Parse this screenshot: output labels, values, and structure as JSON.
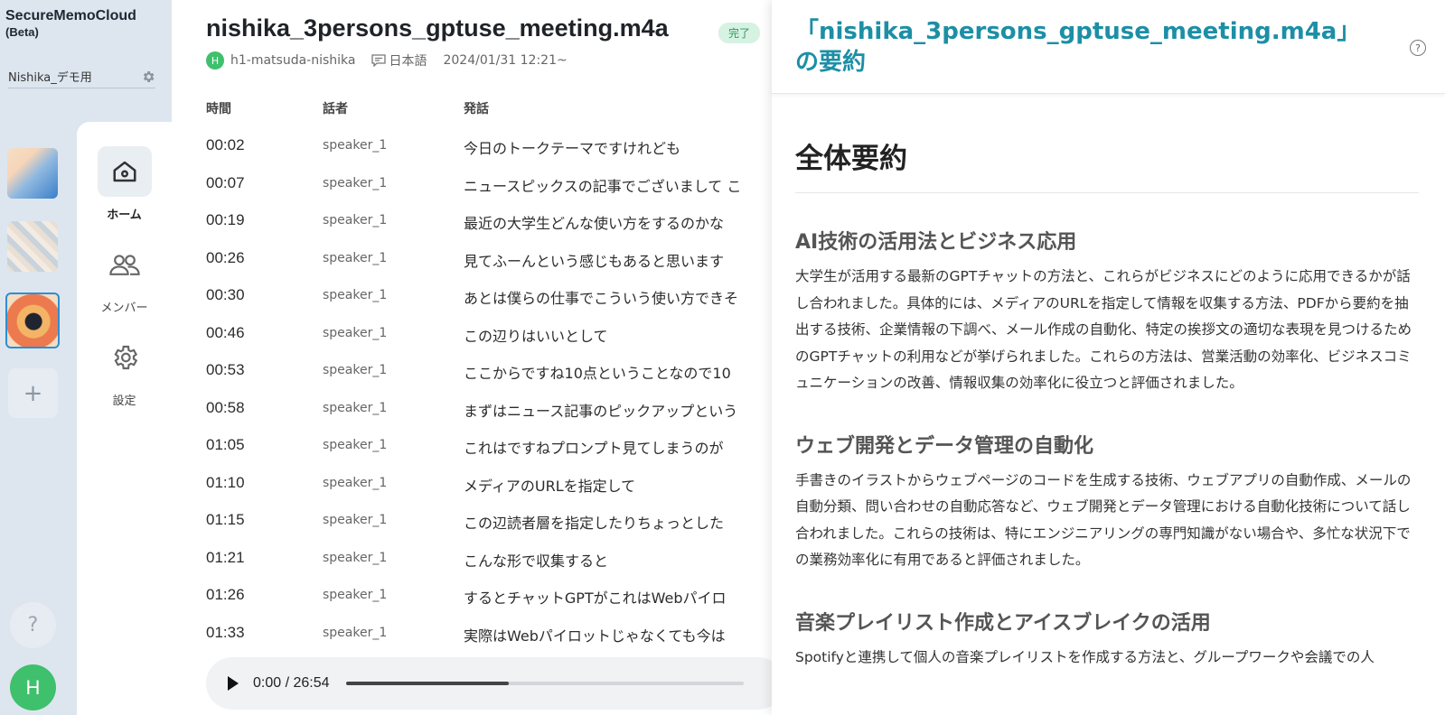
{
  "app": {
    "name": "SecureMemoCloud",
    "beta": "(Beta)"
  },
  "workspace": {
    "name": "Nishika_デモ用"
  },
  "nav": {
    "home": "ホーム",
    "members": "メンバー",
    "settings": "設定"
  },
  "rail": {
    "add": "+",
    "help": "?",
    "user_initial": "H"
  },
  "file": {
    "title": "nishika_3persons_gptuse_meeting.m4a",
    "status": "完了",
    "owner_initial": "H",
    "owner": "h1-matsuda-nishika",
    "language": "日本語",
    "datetime": "2024/01/31 12:21~"
  },
  "table": {
    "headers": {
      "time": "時間",
      "speaker": "話者",
      "utterance": "発話"
    },
    "rows": [
      {
        "time": "00:02",
        "speaker": "speaker_1",
        "text": "今日のトークテーマですけれども"
      },
      {
        "time": "00:07",
        "speaker": "speaker_1",
        "text": "ニュースピックスの記事でございまして こ"
      },
      {
        "time": "00:19",
        "speaker": "speaker_1",
        "text": "最近の大学生どんな使い方をするのかな"
      },
      {
        "time": "00:26",
        "speaker": "speaker_1",
        "text": "見てふーんという感じもあると思います"
      },
      {
        "time": "00:30",
        "speaker": "speaker_1",
        "text": "あとは僕らの仕事でこういう使い方できそ"
      },
      {
        "time": "00:46",
        "speaker": "speaker_1",
        "text": "この辺りはいいとして"
      },
      {
        "time": "00:53",
        "speaker": "speaker_1",
        "text": "ここからですね10点ということなので10"
      },
      {
        "time": "00:58",
        "speaker": "speaker_1",
        "text": "まずはニュース記事のピックアップという"
      },
      {
        "time": "01:05",
        "speaker": "speaker_1",
        "text": "これはですねプロンプト見てしまうのが"
      },
      {
        "time": "01:10",
        "speaker": "speaker_1",
        "text": "メディアのURLを指定して"
      },
      {
        "time": "01:15",
        "speaker": "speaker_1",
        "text": "この辺読者層を指定したりちょっとした"
      },
      {
        "time": "01:21",
        "speaker": "speaker_1",
        "text": "こんな形で収集すると"
      },
      {
        "time": "01:26",
        "speaker": "speaker_1",
        "text": "するとチャットGPTがこれはWebパイロ"
      },
      {
        "time": "01:33",
        "speaker": "speaker_1",
        "text": "実際はWebパイロットじゃなくても今は"
      }
    ]
  },
  "player": {
    "time": "0:00 / 26:54",
    "progress": 0.41
  },
  "summary": {
    "title": "「nishika_3persons_gptuse_meeting.m4a」 の要約",
    "overall_heading": "全体要約",
    "sections": [
      {
        "heading": "AI技術の活用法とビジネス応用",
        "body": "大学生が活用する最新のGPTチャットの方法と、これらがビジネスにどのように応用できるかが話し合われました。具体的には、メディアのURLを指定して情報を収集する方法、PDFから要約を抽出する技術、企業情報の下調べ、メール作成の自動化、特定の挨拶文の適切な表現を見つけるためのGPTチャットの利用などが挙げられました。これらの方法は、営業活動の効率化、ビジネスコミュニケーションの改善、情報収集の効率化に役立つと評価されました。"
      },
      {
        "heading": "ウェブ開発とデータ管理の自動化",
        "body": "手書きのイラストからウェブページのコードを生成する技術、ウェブアプリの自動作成、メールの自動分類、問い合わせの自動応答など、ウェブ開発とデータ管理における自動化技術について話し合われました。これらの技術は、特にエンジニアリングの専門知識がない場合や、多忙な状況下での業務効率化に有用であると評価されました。"
      },
      {
        "heading": "音楽プレイリスト作成とアイスブレイクの活用",
        "body": "Spotifyと連携して個人の音楽プレイリストを作成する方法と、グループワークや会議での人"
      }
    ]
  }
}
